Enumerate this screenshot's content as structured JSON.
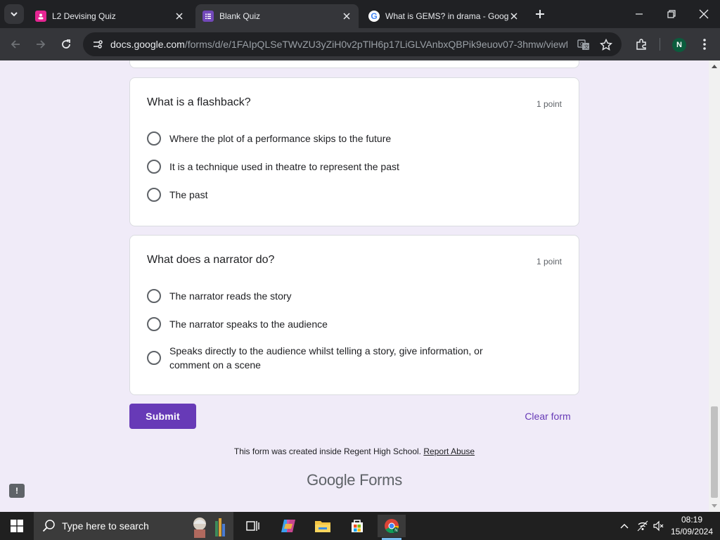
{
  "browser": {
    "tabs": [
      {
        "title": "L2 Devising Quiz",
        "icon": "forms-pink-icon",
        "active": false
      },
      {
        "title": "Blank Quiz",
        "icon": "forms-purple-icon",
        "active": true
      },
      {
        "title": "What is GEMS? in drama - Goog",
        "icon": "google-g-icon",
        "active": false
      }
    ],
    "url_host": "docs.google.com",
    "url_path": "/forms/d/e/1FAIpQLSeTWvZU3yZiH0v2pTlH6p17LiGLVAnbxQBPik9euov07-3hmw/viewf...",
    "profile_initial": "N"
  },
  "questions": [
    {
      "title": "What is a flashback?",
      "points": "1 point",
      "options": [
        "Where the plot of a performance skips to the future",
        "It is a technique used in theatre to represent the past",
        "The past"
      ]
    },
    {
      "title": "What does a narrator do?",
      "points": "1 point",
      "options": [
        "The narrator reads the story",
        "The narrator speaks to the audience",
        "Speaks directly to the audience whilst telling a story, give information, or comment on a scene"
      ]
    }
  ],
  "form": {
    "submit_label": "Submit",
    "clear_label": "Clear form",
    "footer_text": "This form was created inside Regent High School.",
    "report_link": "Report Abuse",
    "logo_google": "Google",
    "logo_forms": "Forms",
    "accent": "#673ab7",
    "background": "#f0ebf8"
  },
  "taskbar": {
    "search_placeholder": "Type here to search",
    "time": "08:19",
    "date": "15/09/2024"
  }
}
